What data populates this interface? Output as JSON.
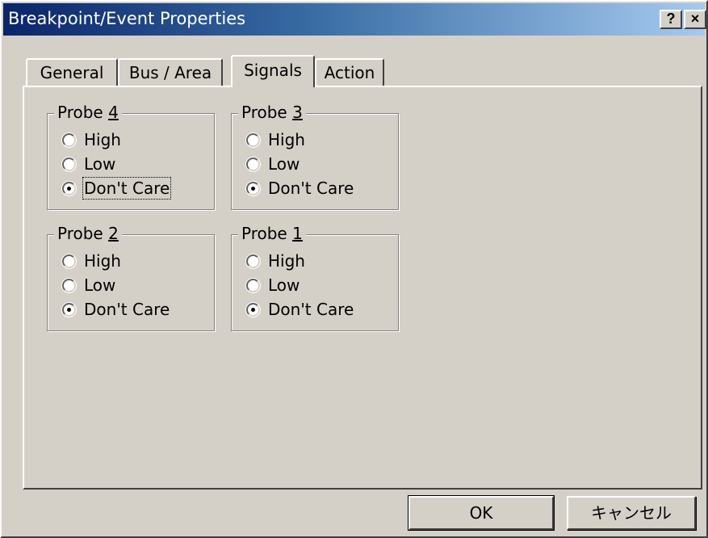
{
  "window": {
    "title": "Breakpoint/Event Properties",
    "help_label": "?",
    "close_label": "×"
  },
  "tabs": [
    {
      "label": "General",
      "active": false
    },
    {
      "label": "Bus / Area",
      "active": false
    },
    {
      "label": "Signals",
      "active": true
    },
    {
      "label": "Action",
      "active": false
    }
  ],
  "groups": [
    {
      "prefix": "Probe ",
      "key": "4",
      "options": [
        "High",
        "Low",
        "Don't Care"
      ],
      "selected": "Don't Care"
    },
    {
      "prefix": "Probe ",
      "key": "3",
      "options": [
        "High",
        "Low",
        "Don't Care"
      ],
      "selected": "Don't Care"
    },
    {
      "prefix": "Probe ",
      "key": "2",
      "options": [
        "High",
        "Low",
        "Don't Care"
      ],
      "selected": "Don't Care"
    },
    {
      "prefix": "Probe ",
      "key": "1",
      "options": [
        "High",
        "Low",
        "Don't Care"
      ],
      "selected": "Don't Care"
    }
  ],
  "buttons": {
    "ok_label": "OK",
    "cancel_label": "キャンセル"
  }
}
